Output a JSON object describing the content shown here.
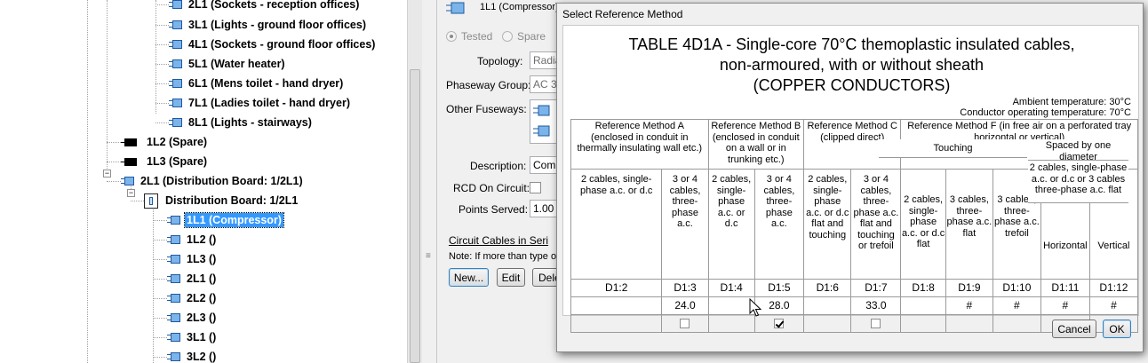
{
  "tree": {
    "nodes": [
      {
        "label": "2L1 (Sockets - reception offices)",
        "icon": "circuit-icon"
      },
      {
        "label": "3L1 (Lights - ground floor offices)",
        "icon": "circuit-icon"
      },
      {
        "label": "4L1 (Sockets - ground floor offices)",
        "icon": "circuit-icon"
      },
      {
        "label": "5L1 (Water heater)",
        "icon": "circuit-icon"
      },
      {
        "label": "6L1 (Mens toilet - hand dryer)",
        "icon": "circuit-icon"
      },
      {
        "label": "7L1 (Ladies toilet - hand dryer)",
        "icon": "circuit-icon"
      },
      {
        "label": "8L1 (Lights - stairways)",
        "icon": "circuit-icon"
      },
      {
        "label": "1L2 (Spare)",
        "icon": "spare-way-icon"
      },
      {
        "label": "1L3 (Spare)",
        "icon": "spare-way-icon"
      },
      {
        "label": "2L1 (Distribution Board: 1/2L1)",
        "icon": "circuit-icon"
      },
      {
        "label": "Distribution Board: 1/2L1",
        "icon": "distribution-board-icon"
      },
      {
        "label": "1L1 (Compressor)",
        "icon": "circuit-icon"
      },
      {
        "label": "1L2 ()",
        "icon": "circuit-icon"
      },
      {
        "label": "1L3 ()",
        "icon": "circuit-icon"
      },
      {
        "label": "2L1 ()",
        "icon": "circuit-icon"
      },
      {
        "label": "2L2 ()",
        "icon": "circuit-icon"
      },
      {
        "label": "2L3 ()",
        "icon": "circuit-icon"
      },
      {
        "label": "3L1 ()",
        "icon": "circuit-icon"
      },
      {
        "label": "3L2 ()",
        "icon": "circuit-icon"
      }
    ],
    "selected": "1L1 (Compressor)",
    "expander_minus": "−",
    "splitter_grip": "≡"
  },
  "form": {
    "header": "1L1 (Compressor)",
    "radio_tested": "Tested",
    "radio_spare": "Spare",
    "topology_label": "Topology:",
    "topology_value": "Radia",
    "phaseway_label": "Phaseway Group:",
    "phaseway_value": "AC 3-",
    "fuseways_label": "Other Fuseways:",
    "description_label": "Description:",
    "description_value": "Comp",
    "rcd_label": "RCD On Circuit:",
    "points_label": "Points Served:",
    "points_value": "1.00",
    "cables_heading": "Circuit Cables in Seri",
    "note": "Note: If more than type of",
    "btn_new": "New...",
    "btn_edit": "Edit",
    "btn_delete": "Dele"
  },
  "dialog": {
    "title": "Select Reference Method",
    "table_title_1": "TABLE 4D1A - Single-core 70°C themoplastic insulated cables,",
    "table_title_2": "non-armoured, with or without sheath",
    "table_title_3": "(COPPER CONDUCTORS)",
    "ambient": "Ambient temperature: 30°C",
    "operating": "Conductor operating temperature: 70°C",
    "methods": {
      "a": "Reference Method A (enclosed in conduit in thermally insulating wall etc.)",
      "b": "Reference Method B (enclosed in conduit on a wall or in trunking etc.)",
      "c": "Reference Method C (clipped direct)",
      "f": "Reference Method F (in free air on a perforated tray horizontal or vertical)"
    },
    "touching": "Touching",
    "spaced": "Spaced by one diameter",
    "spaced_desc": "2 cables, single-phase a.c. or d.c or 3 cables three-phase a.c. flat",
    "col_desc": [
      "2 cables, single-phase a.c. or d.c",
      "3 or 4 cables, three-phase a.c.",
      "2 cables, single-phase a.c. or d.c",
      "3 or 4 cables, three-phase a.c.",
      "2 cables, single-phase a.c. or d.c flat and touching",
      "3 or 4 cables, three-phase a.c. flat and touching or trefoil",
      "2 cables, single-phase a.c. or d.c flat",
      "3 cables, three-phase a.c. flat",
      "3 cables, three-phase a.c. trefoil",
      "Horizontal",
      "Vertical"
    ],
    "codes": [
      "D1:2",
      "D1:3",
      "D1:4",
      "D1:5",
      "D1:6",
      "D1:7",
      "D1:8",
      "D1:9",
      "D1:10",
      "D1:11",
      "D1:12"
    ],
    "values": [
      "",
      "24.0",
      "",
      "28.0",
      "",
      "33.0",
      "",
      "#",
      "#",
      "#",
      "#"
    ],
    "checkbox_columns": [
      1,
      3,
      5
    ],
    "checked_column": 3,
    "btn_cancel": "Cancel",
    "btn_ok": "OK"
  }
}
